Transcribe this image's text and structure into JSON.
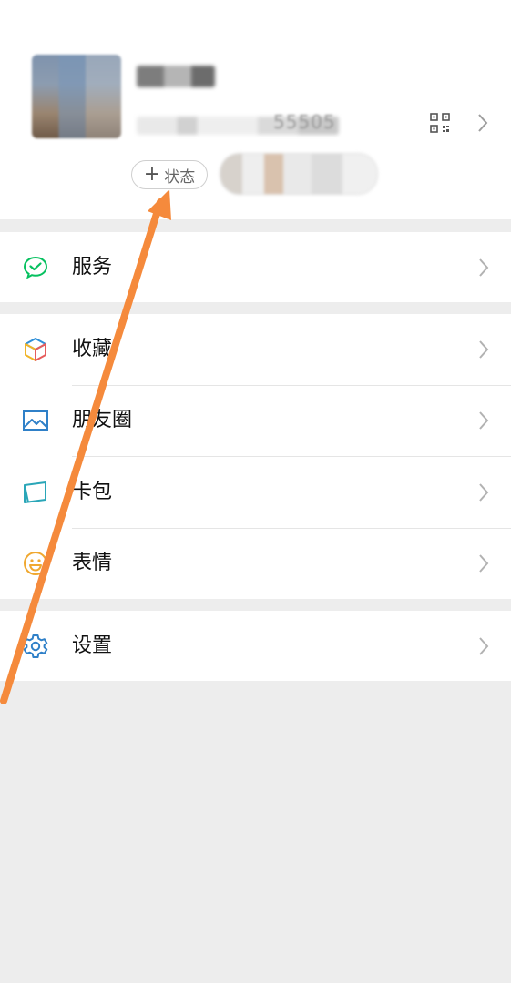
{
  "profile": {
    "id_fragment": "55505",
    "status_button": {
      "plus": "+",
      "label": "状态"
    }
  },
  "menu": {
    "services": {
      "label": "服务",
      "icon": "wechat-pay-icon"
    },
    "favorites": {
      "label": "收藏",
      "icon": "cube-icon"
    },
    "moments": {
      "label": "朋友圈",
      "icon": "image-icon"
    },
    "cards": {
      "label": "卡包",
      "icon": "card-icon"
    },
    "stickers": {
      "label": "表情",
      "icon": "smiley-icon"
    },
    "settings": {
      "label": "设置",
      "icon": "gear-icon"
    }
  },
  "colors": {
    "background": "#ededed",
    "wechat_green": "#07c160",
    "annotation_arrow": "#f58a3c"
  }
}
